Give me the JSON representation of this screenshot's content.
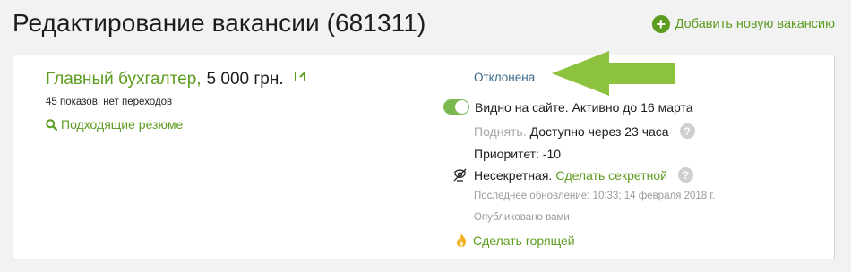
{
  "header": {
    "title": "Редактирование вакансии (681311)",
    "add_label": "Добавить новую вакансию"
  },
  "vacancy": {
    "name": "Главный бухгалтер",
    "separator": ",",
    "salary": "5 000 грн.",
    "stats": "45 показов, нет переходов",
    "resumes_label": "Подходящие резюме"
  },
  "status": {
    "label": "Отклонена",
    "visible_text": "Видно на сайте. Активно до 16 марта",
    "visible_on": true,
    "raise_label": "Поднять.",
    "raise_available": "Доступно через 23 часа",
    "priority": "Приоритет: -10",
    "secret_state": "Несекретная.",
    "secret_link": "Сделать секретной",
    "updated": "Последнее обновление: 10:33; 14 февраля 2018 г.",
    "published": "Опубликовано вами",
    "hot_link": "Сделать горящей",
    "help_glyph": "?"
  },
  "colors": {
    "accent": "#5c9c1f",
    "status_link": "#3d6a8a",
    "arrow": "#8dc23f"
  },
  "icons": [
    "plus-circle-icon",
    "external-link-icon",
    "search-icon",
    "toggle-switch",
    "help-icon",
    "unsecret-icon",
    "fire-icon",
    "arrow-pointer"
  ]
}
